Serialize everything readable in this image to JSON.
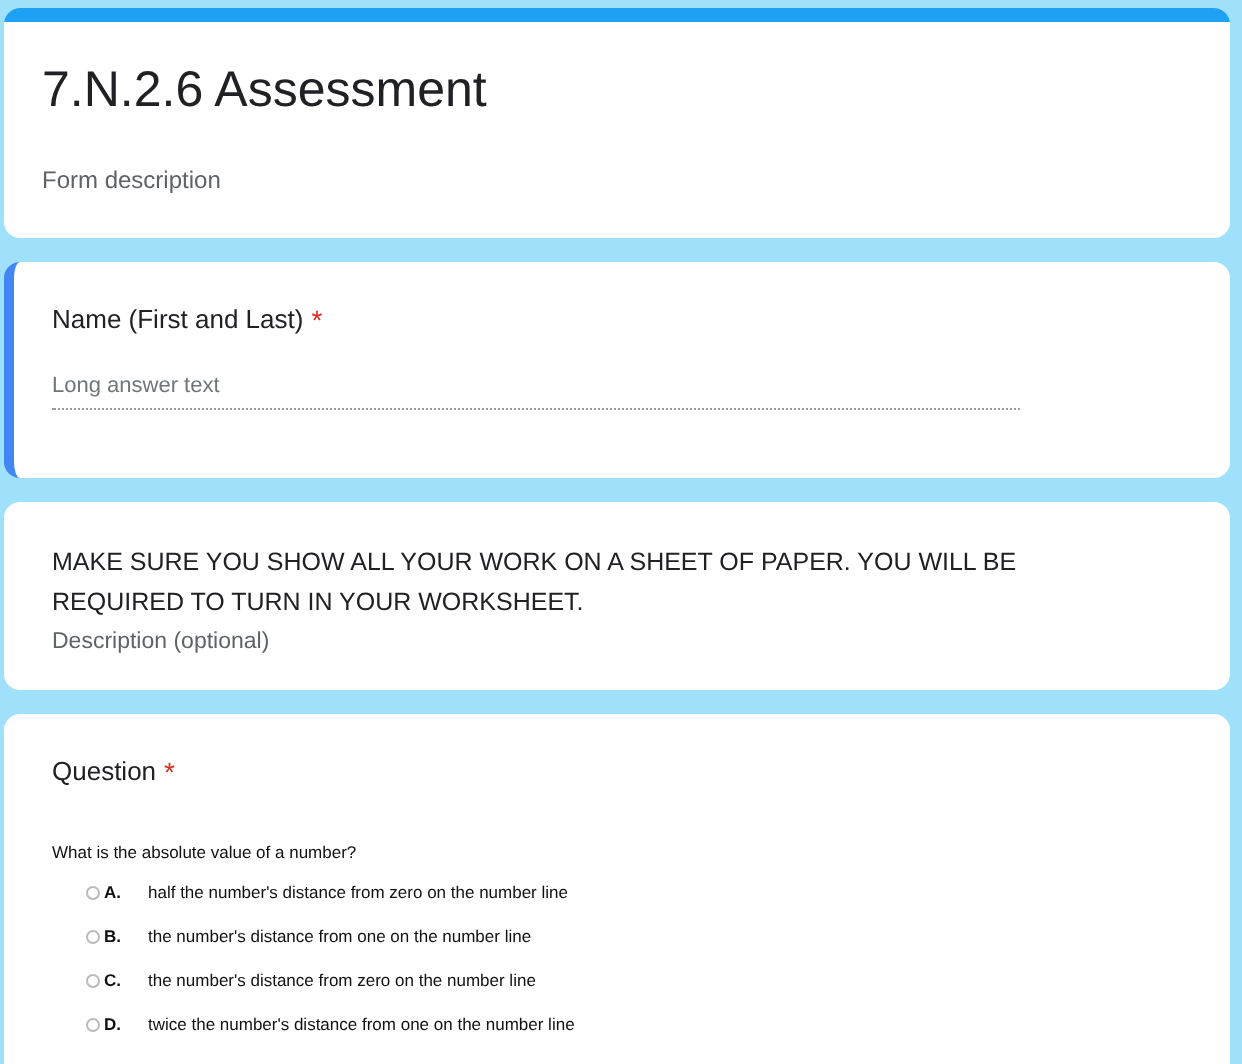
{
  "form": {
    "title": "7.N.2.6 Assessment",
    "description": "Form description"
  },
  "items": [
    {
      "kind": "question",
      "focused": true,
      "title": "Name (First and Last)",
      "required": true,
      "required_mark": "*",
      "answer_placeholder": "Long answer text"
    },
    {
      "kind": "section_text",
      "focused": false,
      "title": "MAKE SURE YOU SHOW ALL YOUR WORK ON A SHEET OF PAPER. YOU WILL BE REQUIRED TO TURN IN YOUR WORKSHEET.",
      "description_placeholder": "Description (optional)"
    },
    {
      "kind": "image_question",
      "focused": false,
      "title": "Question",
      "required": true,
      "required_mark": "*",
      "prompt": "What is the absolute value of a number?",
      "options": [
        {
          "letter": "A.",
          "text": "half the number's distance from zero on the number line",
          "selected": false
        },
        {
          "letter": "B.",
          "text": "the number's distance from one on the number line",
          "selected": false
        },
        {
          "letter": "C.",
          "text": "the number's distance from zero on the number line",
          "selected": false
        },
        {
          "letter": "D.",
          "text": "twice the number's distance from one on the number line",
          "selected": false
        }
      ]
    }
  ]
}
